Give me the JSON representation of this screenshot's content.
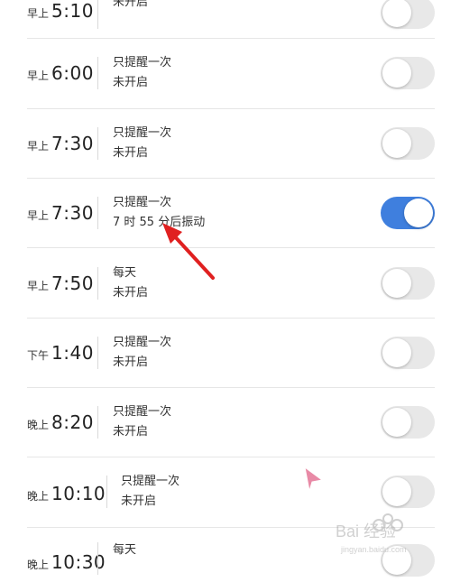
{
  "alarms": [
    {
      "period": "早上",
      "time": "5:10",
      "line1": "",
      "line2": "未开启",
      "on": false
    },
    {
      "period": "早上",
      "time": "6:00",
      "line1": "只提醒一次",
      "line2": "未开启",
      "on": false
    },
    {
      "period": "早上",
      "time": "7:30",
      "line1": "只提醒一次",
      "line2": "未开启",
      "on": false
    },
    {
      "period": "早上",
      "time": "7:30",
      "line1": "只提醒一次",
      "line2": "7 时 55 分后振动",
      "on": true
    },
    {
      "period": "早上",
      "time": "7:50",
      "line1": "每天",
      "line2": "未开启",
      "on": false
    },
    {
      "period": "下午",
      "time": "1:40",
      "line1": "只提醒一次",
      "line2": "未开启",
      "on": false
    },
    {
      "period": "晚上",
      "time": "8:20",
      "line1": "只提醒一次",
      "line2": "未开启",
      "on": false
    },
    {
      "period": "晚上",
      "time": "10:10",
      "line1": "只提醒一次",
      "line2": "未开启",
      "on": false
    },
    {
      "period": "晚上",
      "time": "10:30",
      "line1": "每天",
      "line2": "",
      "on": false
    }
  ],
  "colors": {
    "toggle_on": "#3f7fde",
    "toggle_off": "#e8e8e8",
    "arrow": "#e02020",
    "cursor": "#e88aa6"
  },
  "watermark": {
    "text": "Bai 经验",
    "sub": "jingyan.baidu.com"
  }
}
